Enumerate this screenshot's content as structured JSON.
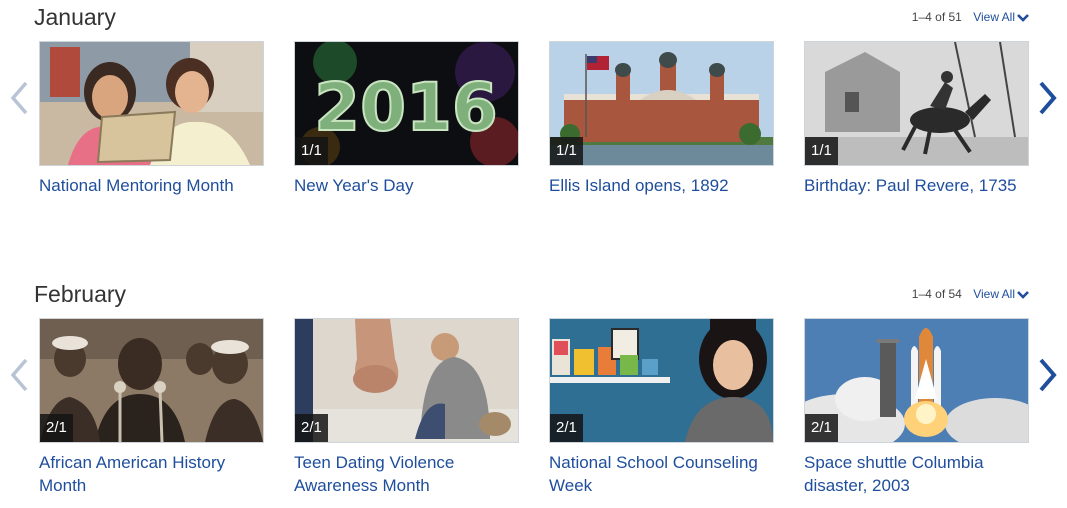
{
  "sections": [
    {
      "title": "January",
      "count": "1–4 of 51",
      "view_all": "View All",
      "cards": [
        {
          "caption": "National Mentoring Month",
          "badge": ""
        },
        {
          "caption": "New Year's Day",
          "badge": "1/1"
        },
        {
          "caption": "Ellis Island opens, 1892",
          "badge": "1/1"
        },
        {
          "caption": "Birthday: Paul Revere, 1735",
          "badge": "1/1"
        }
      ]
    },
    {
      "title": "February",
      "count": "1–4 of 54",
      "view_all": "View All",
      "cards": [
        {
          "caption": "African American History Month",
          "badge": "2/1"
        },
        {
          "caption": "Teen Dating Violence Awareness Month",
          "badge": "2/1"
        },
        {
          "caption": "National School Counseling Week",
          "badge": "2/1"
        },
        {
          "caption": "Space shuttle Columbia disaster, 2003",
          "badge": "2/1"
        }
      ]
    }
  ],
  "image_text": {
    "year": "2016"
  },
  "colors": {
    "link": "#1f4e9c",
    "arrow_active": "#1f4e9c",
    "arrow_inactive": "#b8c4d6"
  }
}
